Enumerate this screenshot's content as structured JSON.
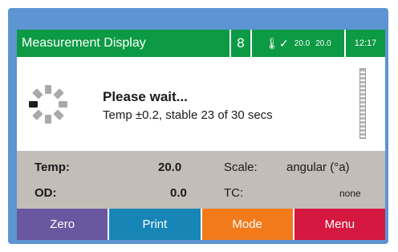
{
  "title_bar": {
    "title": "Measurement Display",
    "lock_glyph": "8",
    "thermo_icon": "thermometer-check-icon",
    "temp_set": "20.0",
    "temp_current": "20.0",
    "time": "12:17"
  },
  "status": {
    "message": "Please wait...",
    "detail": "Temp ±0.2, stable 23 of 30 secs",
    "stable_progress": 0.77
  },
  "readings": {
    "temp_label": "Temp:",
    "temp_value": "20.0",
    "scale_label": "Scale:",
    "scale_value": "angular (°a)",
    "od_label": "OD:",
    "od_value": "0.0",
    "tc_label": "TC:",
    "tc_value": "none"
  },
  "softkeys": {
    "zero": "Zero",
    "print": "Print",
    "mode": "Mode",
    "menu": "Menu"
  },
  "colors": {
    "frame": "#5d94d2",
    "title_bar": "#0d9a45",
    "readings_bg": "#c3bdb8",
    "zero": "#6a579f",
    "print": "#1786b7",
    "mode": "#f27a1b",
    "menu": "#d5183f"
  }
}
